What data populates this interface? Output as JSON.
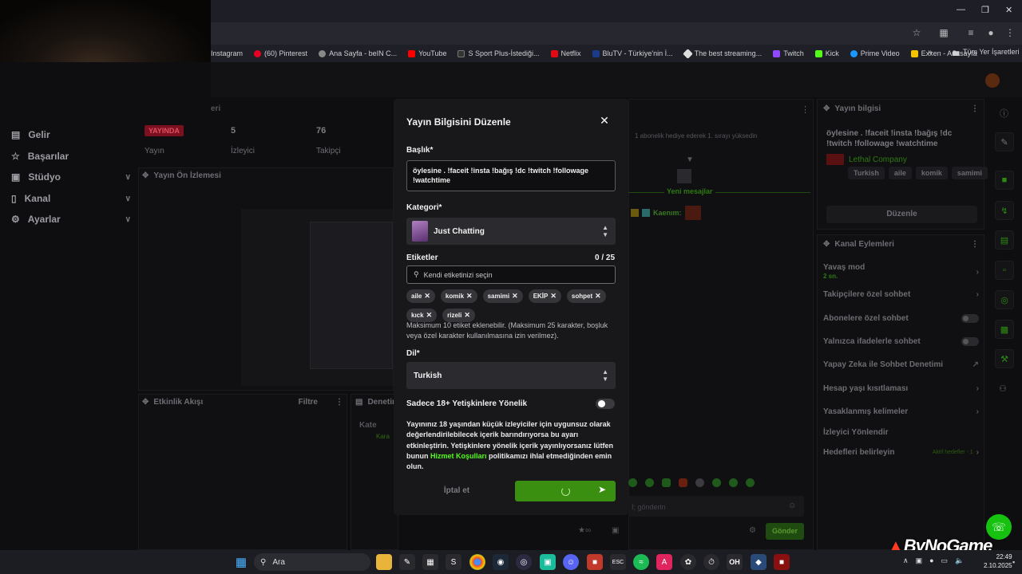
{
  "bookmarks": [
    "Instagram",
    "(60) Pinterest",
    "Ana Sayfa - beIN C...",
    "YouTube",
    "S Sport Plus-İstediği...",
    "Netflix",
    "BluTV - Türkiye'nin İ...",
    "The best streaming...",
    "Twitch",
    "Kick",
    "Prime Video",
    "Exxen - Anasayfa"
  ],
  "bookmarks_all": "Tüm Yer İşaretleri",
  "nav": [
    {
      "label": "Gelir",
      "icon": "wallet-icon"
    },
    {
      "label": "Başarılar",
      "icon": "trophy-icon"
    },
    {
      "label": "Stüdyo",
      "icon": "studio-icon"
    },
    {
      "label": "Kanal",
      "icon": "channel-icon"
    },
    {
      "label": "Ayarlar",
      "icon": "gear-icon"
    }
  ],
  "stats": {
    "live_badge": "YAYINDA",
    "live_label": "Yayın",
    "viewers_value": "5",
    "viewers_label": "İzleyici",
    "followers_value": "76",
    "followers_label": "Takipçi"
  },
  "dashboard": {
    "preview_title": "Yayın Ön İzlemesi",
    "activity_title": "Etkinlik Akışı",
    "filter_label": "Filtre",
    "denetim_label": "Denetim",
    "kate_label": "Kate",
    "kara_label": "Kara",
    "events_header_fragment": "eri"
  },
  "chat": {
    "sub_notice": "1 abonelik hediye ederek 1. sırayı yüksedin",
    "new_messages": "Yeni mesajlar",
    "chat_user": "Kaenım:",
    "input_placeholder": "I; gönderin",
    "send_label": "Gönder"
  },
  "stream_info": {
    "title": "Yayın bilgisi",
    "stream_title": "öylesine . !faceit !insta !bağış !dc !twitch !followage !watchtime",
    "game": "Lethal Company",
    "tags": [
      "Turkish",
      "aile",
      "komik",
      "samimi"
    ],
    "edit_label": "Düzenle"
  },
  "channel_actions": {
    "title": "Kanal Eylemleri",
    "rows": [
      {
        "label": "Yavaş mod",
        "sub": "2 sn."
      },
      {
        "label": "Takipçilere özel sohbet"
      },
      {
        "label": "Abonelere özel sohbet"
      },
      {
        "label": "Yalnızca ifadelerle sohbet"
      },
      {
        "label": "Yapay Zeka ile Sohbet Denetimi"
      },
      {
        "label": "Hesap yaşı kısıtlaması"
      },
      {
        "label": "Yasaklanmış kelimeler"
      },
      {
        "label": "İzleyici Yönlendir"
      },
      {
        "label": "Hedefleri belirleyin",
        "sub": "Aktif hedefler - 1"
      }
    ]
  },
  "modal": {
    "title": "Yayın Bilgisini Düzenle",
    "title_label": "Başlık*",
    "title_value": "öylesine . !faceit !insta !bağış !dc !twitch !followage !watchtime",
    "category_label": "Kategori*",
    "category_value": "Just Chatting",
    "tags_label": "Etiketler",
    "tags_count": "0 / 25",
    "tags_placeholder": "Kendi etiketinizi seçin",
    "tags": [
      "aile",
      "komik",
      "samimi",
      "EKİP",
      "sohpet",
      "kıck",
      "rizeli"
    ],
    "tags_help": "Maksimum 10 etiket eklenebilir. (Maksimum 25 karakter, boşluk veya özel karakter kullanılmasına izin verilmez).",
    "language_label": "Dil*",
    "language_value": "Turkish",
    "adult_label": "Sadece 18+ Yetişkinlere Yönelik",
    "adult_on": false,
    "adult_text_1": "Yayınınız 18 yaşından küçük izleyiciler için uygunsuz olarak değerlendirilebilecek içerik barındırıyorsa bu ayarı etkinleştirin. Yetişkinlere yönelik içerik yayınlıyorsanız lütfen bunun",
    "adult_link": "Hizmet Koşulları",
    "adult_text_2": "politikamızı ihlal etmediğinden emin olun.",
    "cancel_label": "İptal et"
  },
  "taskbar": {
    "search_label": "Ara",
    "time": "22:49",
    "date": "2.10.2025"
  },
  "watermark": "ByNoGame",
  "colors": {
    "kick_green": "#53fc18",
    "save_green": "#3a8f10",
    "live_red": "#e05060"
  }
}
